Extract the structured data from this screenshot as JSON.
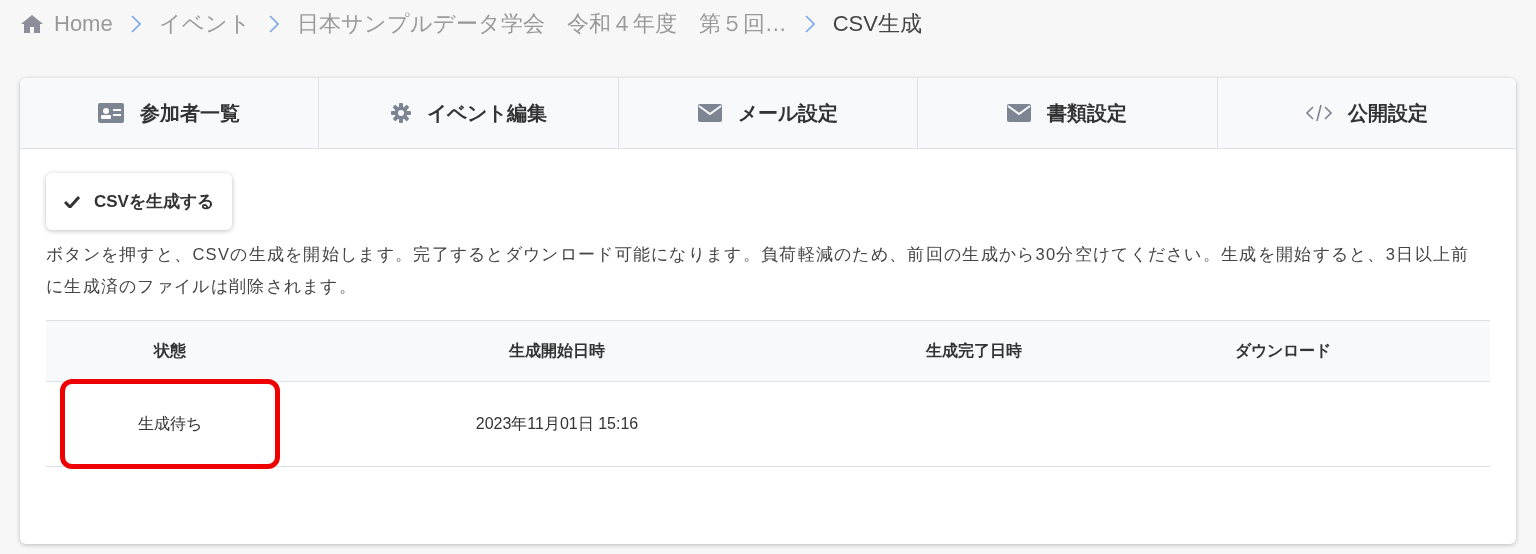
{
  "breadcrumb": [
    {
      "label": "Home",
      "kind": "home",
      "current": false
    },
    {
      "label": "イベント",
      "current": false
    },
    {
      "label": "日本サンプルデータ学会　令和４年度　第５回…",
      "current": false
    },
    {
      "label": "CSV生成",
      "current": true
    }
  ],
  "tabs": [
    {
      "label": "参加者一覧",
      "kind": "card"
    },
    {
      "label": "イベント編集",
      "kind": "gear"
    },
    {
      "label": "メール設定",
      "kind": "mail"
    },
    {
      "label": "書類設定",
      "kind": "mail"
    },
    {
      "label": "公開設定",
      "kind": "code"
    }
  ],
  "generate_button": {
    "label": "CSVを生成する"
  },
  "description": "ボタンを押すと、CSVの生成を開始します。完了するとダウンロード可能になります。負荷軽減のため、前回の生成から30分空けてください。生成を開始すると、3日以上前に生成済のファイルは削除されます。",
  "table": {
    "columns": [
      "状態",
      "生成開始日時",
      "生成完了日時",
      "ダウンロード"
    ],
    "rows": [
      {
        "cells": [
          "生成待ち",
          "2023年11月01日 15:16"
        ],
        "highlighted": true
      }
    ]
  }
}
